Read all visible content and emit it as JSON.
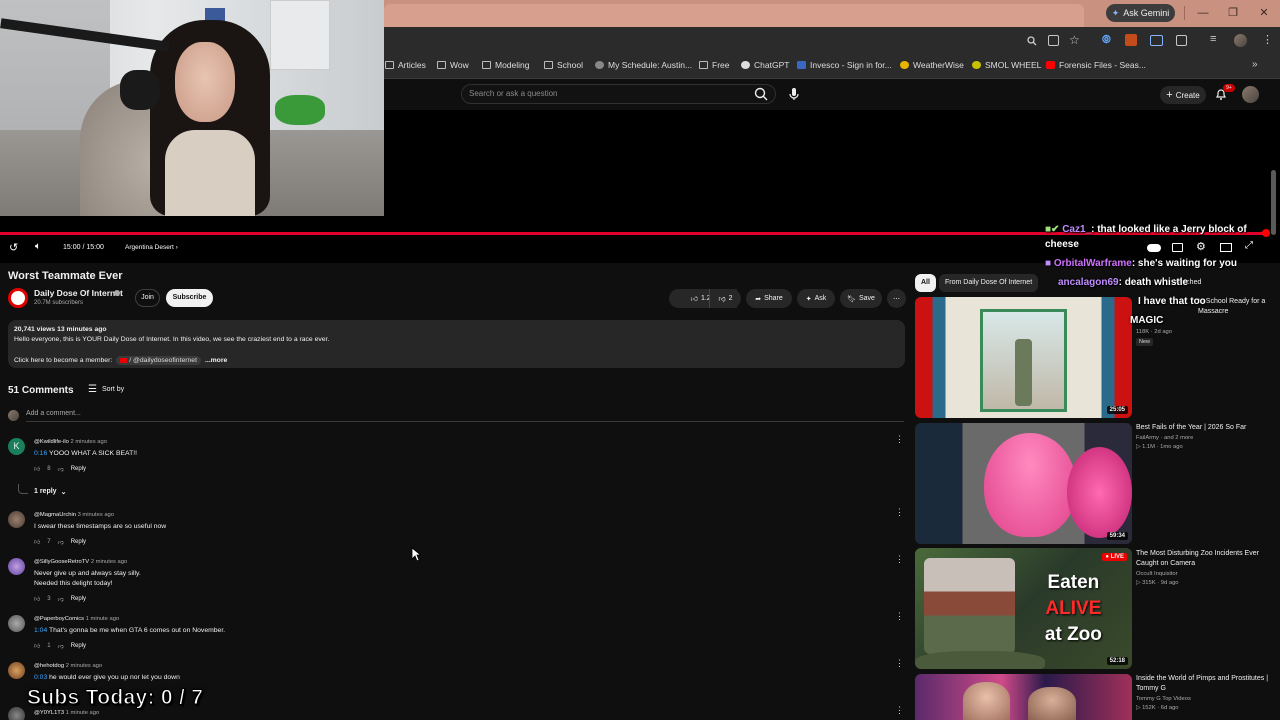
{
  "browser": {
    "ask_gemini": "Ask Gemini",
    "bookmarks": [
      "Articles",
      "Wow",
      "Modeling",
      "School",
      "My Schedule: Austin...",
      "Free",
      "ChatGPT",
      "Invesco - Sign in for...",
      "WeatherWise",
      "SMOL WHEEL",
      "Forensic Files - Seas..."
    ]
  },
  "youtube_header": {
    "search_placeholder": "Search or ask a question",
    "create_label": "Create",
    "notification_count": "9+"
  },
  "player": {
    "time": "15:00 / 15:00",
    "chapter": "Argentina Desert ›",
    "progress": 1.0
  },
  "video": {
    "title": "Worst Teammate Ever",
    "channel": "Daily Dose Of Internet",
    "subscribers": "20.7M subscribers",
    "join": "Join",
    "subscribe": "Subscribe",
    "likes": "1.2K",
    "dislikes": "2",
    "share": "Share",
    "ask": "Ask",
    "save": "Save",
    "description": {
      "meta": "20,741 views  13 minutes ago",
      "line1": "Hello everyone, this is YOUR Daily Dose of Internet. In this video, we see the craziest end to a race ever.",
      "line2_prefix": "Click here to become a member:",
      "handle": " / @dailydoseofinternet",
      "more": "...more"
    }
  },
  "comments": {
    "count": "51 Comments",
    "sort_by": "Sort by",
    "add_placeholder": "Add a comment...",
    "reply_label": "Reply",
    "items": [
      {
        "user": "@Kwildlife-ilo",
        "time": "2 minutes ago",
        "ts": "0:16",
        "text": " YOOO WHAT A SICK BEAT!!",
        "likes": "8",
        "replies": "1 reply"
      },
      {
        "user": "@MagmaUrchin",
        "time": "3 minutes ago",
        "ts": "",
        "text": "I swear these timestamps are so useful now",
        "likes": "7"
      },
      {
        "user": "@SillyGooseRetroTV",
        "time": "2 minutes ago",
        "ts": "",
        "text": "Never give up and always stay silly.",
        "text2": "Needed this delight today!",
        "likes": "3"
      },
      {
        "user": "@PaperboyComics",
        "time": "1 minute ago",
        "ts": "1:04",
        "text": " That's gonna be me when GTA 6 comes out on November.",
        "likes": "1"
      },
      {
        "user": "@hehotdog",
        "time": "2 minutes ago",
        "ts": "0:03",
        "text": " he would ever give you up nor let you down",
        "likes": ""
      },
      {
        "user": "@Y0YL1T3",
        "time": "1 minute ago",
        "ts": "",
        "text": "",
        "likes": ""
      }
    ]
  },
  "recommendations": {
    "chips": [
      "All",
      "From Daily Dose Of Internet",
      "Watched"
    ],
    "items": [
      {
        "title": "to School Ready for a Massacre",
        "channel": "",
        "meta1": "118K",
        "meta2": "2d ago",
        "badge": "New",
        "duration": "25:05"
      },
      {
        "title": "Best Fails of the Year | 2026 So Far",
        "channel": "FailArmy · and 2 more",
        "meta1": "1.1M",
        "meta2": "1mo ago",
        "duration": "59:34"
      },
      {
        "title": "The Most Disturbing Zoo Incidents Ever Caught on Camera",
        "channel": "Occult Inquisitor",
        "meta1": "315K",
        "meta2": "9d ago",
        "duration": "52:18",
        "thumb_text": [
          "Eaten",
          "ALIVE",
          "at Zoo"
        ],
        "live": "LIVE"
      },
      {
        "title": "Inside the World of Pimps and Prostitutes | Tommy G",
        "channel": "Tommy G Top Videos",
        "meta1": "152K",
        "meta2": "6d ago",
        "duration": ""
      }
    ]
  },
  "stream_overlay": {
    "chat": [
      {
        "user": "Caz1_",
        "msg": ": that looked like a Jerry block of"
      },
      {
        "user": "",
        "msg": "cheese"
      },
      {
        "user": "OrbitalWarframe",
        "msg": ": she's waiting for you"
      },
      {
        "user": "ancalagon69",
        "msg": ": death whistle"
      },
      {
        "user": "",
        "msg": "I have that too"
      },
      {
        "user": "",
        "msg": "MAGIC"
      }
    ],
    "subs_goal": "Subs Today: 0 / 7"
  }
}
